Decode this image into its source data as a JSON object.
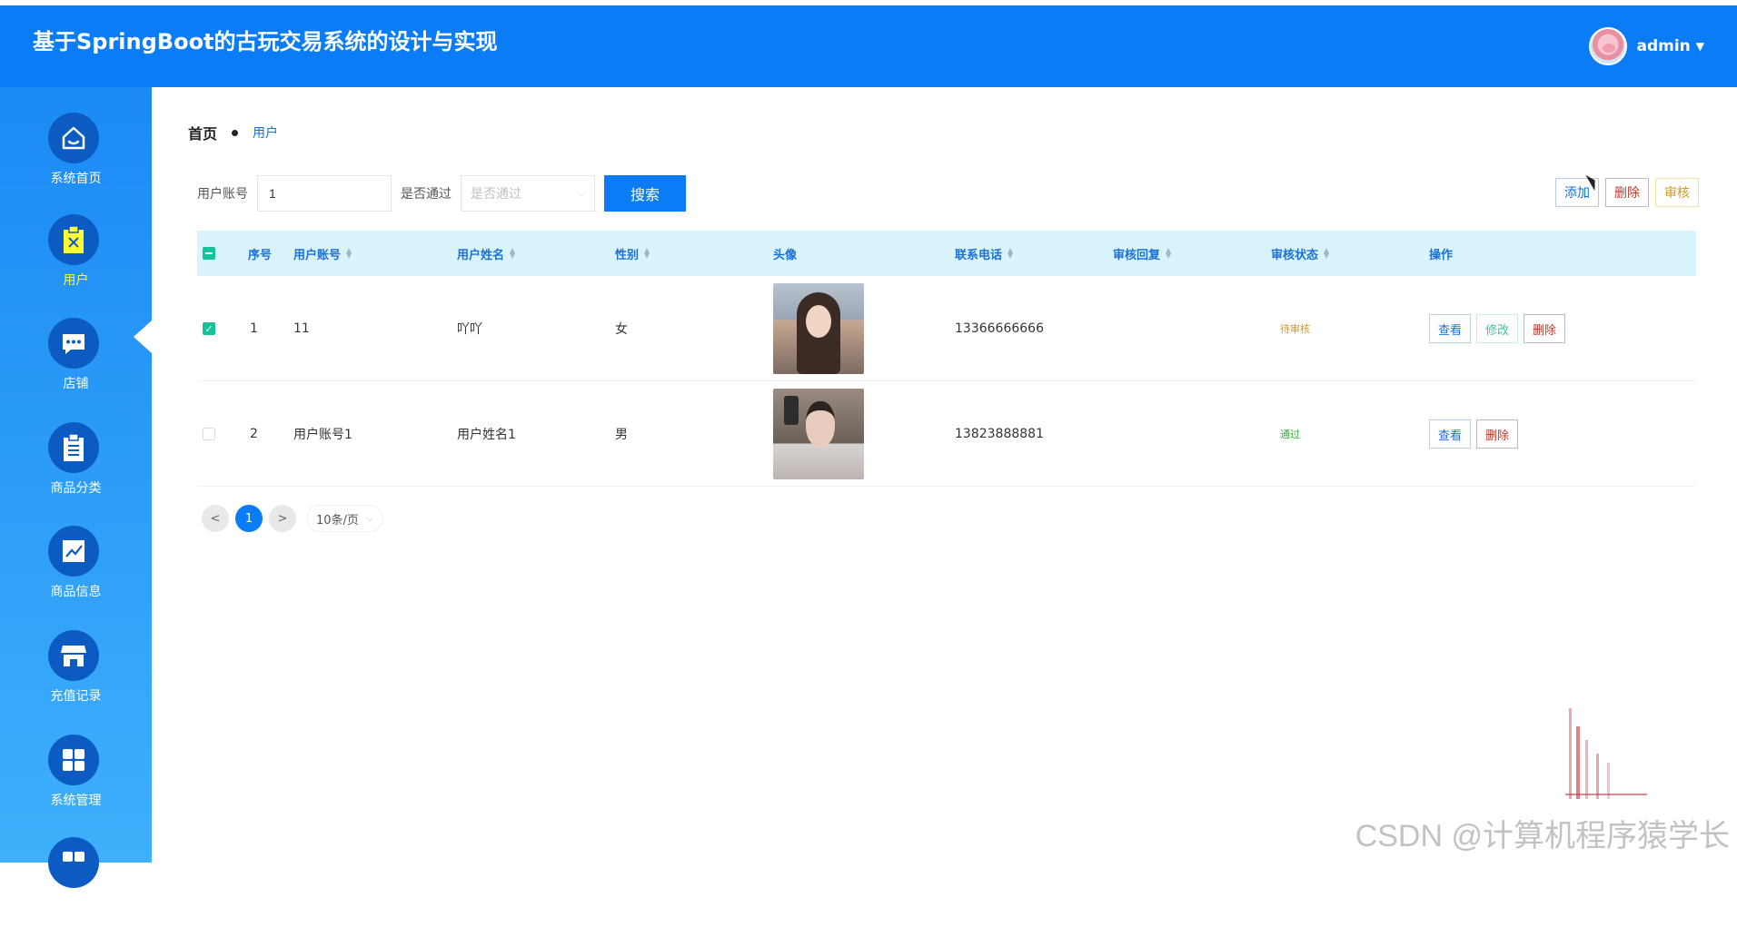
{
  "app": {
    "title": "基于SpringBoot的古玩交易系统的设计与实现"
  },
  "user": {
    "name": "admin"
  },
  "sidebar": {
    "items": [
      {
        "label": "系统首页",
        "icon": "home-icon",
        "active": false
      },
      {
        "label": "用户",
        "icon": "user-clipboard-icon",
        "active": true
      },
      {
        "label": "店铺",
        "icon": "chat-bubble-icon",
        "active": false
      },
      {
        "label": "商品分类",
        "icon": "clipboard-list-icon",
        "active": false
      },
      {
        "label": "商品信息",
        "icon": "trend-chart-icon",
        "active": false
      },
      {
        "label": "充值记录",
        "icon": "store-icon",
        "active": false
      },
      {
        "label": "系统管理",
        "icon": "grid-icon",
        "active": false
      }
    ]
  },
  "breadcrumb": {
    "home": "首页",
    "current": "用户"
  },
  "search": {
    "account_label": "用户账号",
    "account_value": "1",
    "pass_label": "是否通过",
    "pass_placeholder": "是否通过",
    "button": "搜索"
  },
  "actions": {
    "add": "添加",
    "delete": "删除",
    "audit": "审核"
  },
  "table": {
    "headers": {
      "index": "序号",
      "account": "用户账号",
      "name": "用户姓名",
      "gender": "性别",
      "avatar": "头像",
      "phone": "联系电话",
      "reply": "审核回复",
      "status": "审核状态",
      "ops": "操作"
    },
    "rows": [
      {
        "index": "1",
        "account": "11",
        "name": "吖吖",
        "gender": "女",
        "phone": "13366666666",
        "reply": "",
        "status": "待审核",
        "checked": true,
        "ops": {
          "view": "查看",
          "edit": "修改",
          "delete": "删除"
        }
      },
      {
        "index": "2",
        "account": "用户账号1",
        "name": "用户姓名1",
        "gender": "男",
        "phone": "13823888881",
        "reply": "",
        "status": "通过",
        "checked": false,
        "ops": {
          "view": "查看",
          "delete": "删除"
        }
      }
    ]
  },
  "pager": {
    "prev": "<",
    "current": "1",
    "next": ">",
    "page_size": "10条/页"
  },
  "watermark": "CSDN @计算机程序猿学长",
  "colors": {
    "primary": "#0a7cf5",
    "header_row": "#d9f4fc",
    "pending": "#d19a1d",
    "pass": "#33b03a"
  }
}
